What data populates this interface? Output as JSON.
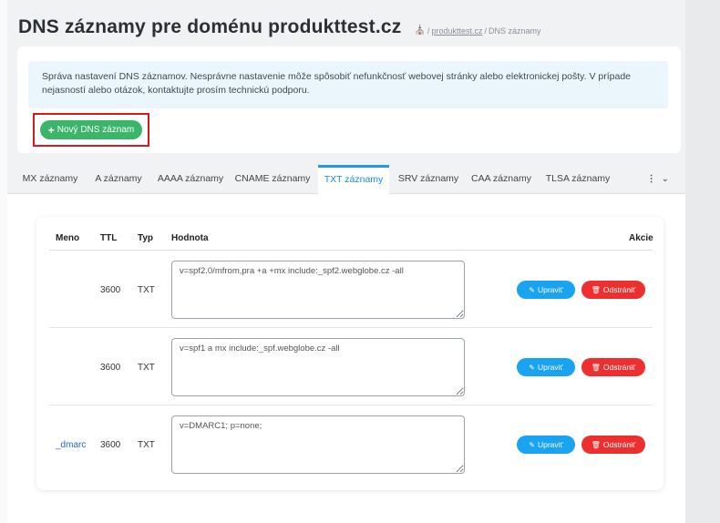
{
  "page_title": "DNS záznamy pre doménu produkttest.cz",
  "breadcrumb": {
    "home_icon": "home-icon",
    "separator": "/",
    "domain_link": "produkttest.cz",
    "current": "DNS záznamy"
  },
  "info_text": "Správa nastavení DNS záznamov. Nesprávne nastavenie môže spôsobiť nefunkčnosť webovej stránky alebo elektronickej pošty. V prípade nejasností alebo otázok, kontaktujte prosím technickú podporu.",
  "new_record_button": {
    "icon": "plus-icon",
    "label": "Nový DNS záznam"
  },
  "tabs": [
    {
      "label": "MX záznamy"
    },
    {
      "label": "A záznamy"
    },
    {
      "label": "AAAA záznamy"
    },
    {
      "label": "CNAME záznamy"
    },
    {
      "label": "TXT záznamy",
      "active": true
    },
    {
      "label": "SRV záznamy"
    },
    {
      "label": "CAA záznamy"
    },
    {
      "label": "TLSA záznamy"
    }
  ],
  "tabs_more": {
    "dots": "⋮",
    "chevron": "⌄"
  },
  "table": {
    "headers": {
      "name": "Meno",
      "ttl": "TTL",
      "type": "Typ",
      "value": "Hodnota",
      "actions": "Akcie"
    },
    "rows": [
      {
        "name": "",
        "ttl": "3600",
        "type": "TXT",
        "value": "v=spf2.0/mfrom,pra +a +mx include:_spf2.webglobe.cz -all"
      },
      {
        "name": "",
        "ttl": "3600",
        "type": "TXT",
        "value": "v=spf1 a mx include:_spf.webglobe.cz -all"
      },
      {
        "name": "_dmarc",
        "ttl": "3600",
        "type": "TXT",
        "value": "v=DMARC1; p=none;"
      }
    ],
    "edit_label": "Upraviť",
    "delete_label": "Odstrániť"
  },
  "colors": {
    "accent": "#2196f3",
    "new_button": "#3bb56a",
    "edit_button": "#1aa3f0",
    "delete_button": "#ee2f2f",
    "highlight_frame": "#d01c24"
  }
}
